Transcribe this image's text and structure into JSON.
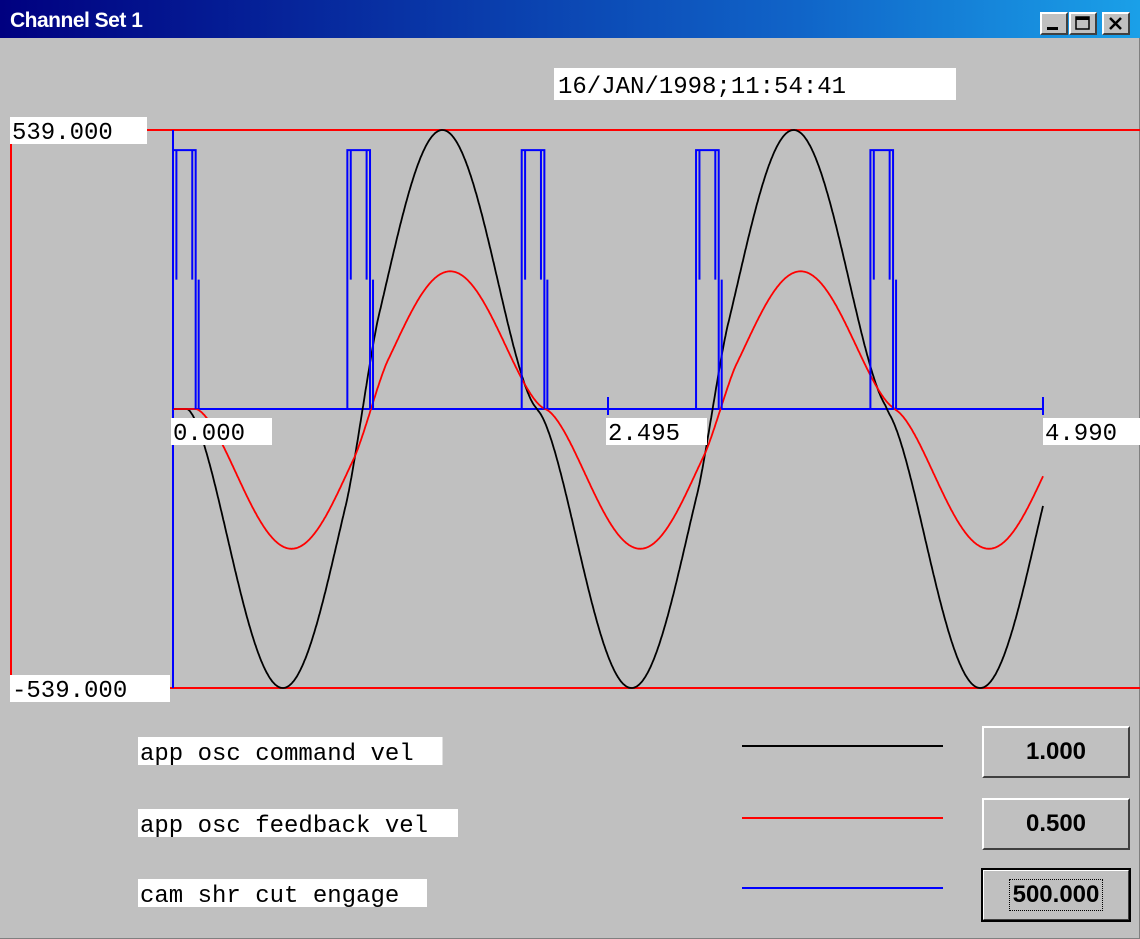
{
  "window": {
    "title": "Channel Set 1",
    "controls": [
      "minimize-icon",
      "maximize-icon",
      "close-icon"
    ]
  },
  "timestamp": "16/JAN/1998;11:54:41",
  "colors": {
    "background": "#c0c0c0",
    "border": "#ff0000",
    "command": "#000000",
    "feedback": "#ff0000",
    "engage": "#0000ff",
    "label_bg": "#ffffff"
  },
  "chart_data": {
    "type": "line",
    "y_max_label": "539.000",
    "y_min_label": "-539.000",
    "x_tick_labels": [
      "0.000",
      "2.495",
      "4.990"
    ],
    "ylim": [
      -539,
      539
    ],
    "xlim": [
      0,
      4.99
    ],
    "grid": false,
    "series": [
      {
        "name": "app osc command vel",
        "color": "#000000",
        "scale": "1.000",
        "pulses": [
          {
            "center": 1.545,
            "half_width": 0.55,
            "peak": 539
          },
          {
            "center": 0.63,
            "half_width": 0.55,
            "peak": -539
          },
          {
            "center": 3.56,
            "half_width": 0.55,
            "peak": 539
          },
          {
            "center": 2.63,
            "half_width": 0.55,
            "peak": -539
          },
          {
            "center": 4.63,
            "half_width": 0.55,
            "peak": -539
          }
        ]
      },
      {
        "name": "app osc feedback vel",
        "color": "#ff0000",
        "scale": "0.500",
        "pulses": [
          {
            "center": 1.59,
            "half_width": 0.55,
            "peak": 266
          },
          {
            "center": 0.68,
            "half_width": 0.55,
            "peak": -270
          },
          {
            "center": 3.6,
            "half_width": 0.55,
            "peak": 266
          },
          {
            "center": 2.68,
            "half_width": 0.55,
            "peak": -270
          },
          {
            "center": 4.68,
            "half_width": 0.55,
            "peak": -270
          }
        ]
      },
      {
        "name": "cam shr cut engage",
        "color": "#0000ff",
        "scale": "500.000",
        "pulse_level": 500,
        "mid_level": 250,
        "pulses": [
          {
            "start": 0.0,
            "end": 0.13
          },
          {
            "start": 1.0,
            "end": 1.13
          },
          {
            "start": 2.0,
            "end": 2.13
          },
          {
            "start": 3.0,
            "end": 3.13
          },
          {
            "start": 4.0,
            "end": 4.13
          }
        ]
      }
    ]
  },
  "legend": [
    {
      "label": "app osc command vel",
      "color": "#000000",
      "scale": "1.000"
    },
    {
      "label": "app osc feedback vel",
      "color": "#ff0000",
      "scale": "0.500"
    },
    {
      "label": "cam shr cut engage",
      "color": "#0000ff",
      "scale": "500.000"
    }
  ]
}
